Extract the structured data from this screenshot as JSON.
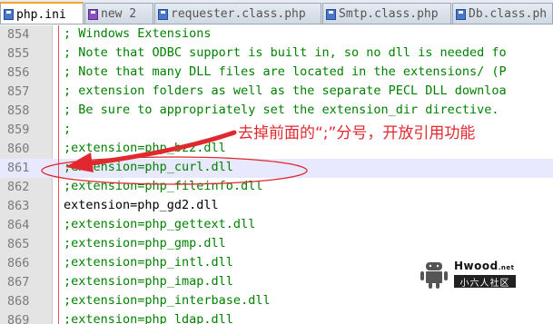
{
  "tabs": [
    {
      "label": "php.ini",
      "icon": "save-icon",
      "active": true
    },
    {
      "label": "new  2",
      "icon": "doc-icon",
      "active": false
    },
    {
      "label": "requester.class.php",
      "icon": "save-icon",
      "active": false
    },
    {
      "label": "Smtp.class.php",
      "icon": "save-icon",
      "active": false
    },
    {
      "label": "Db.class.ph",
      "icon": "save-icon",
      "active": false
    }
  ],
  "editor": {
    "current_line": "861",
    "lines": [
      {
        "num": "854",
        "text": "; Windows Extensions",
        "type": "comment"
      },
      {
        "num": "855",
        "text": "; Note that ODBC support is built in, so no dll is needed fo",
        "type": "comment"
      },
      {
        "num": "856",
        "text": "; Note that many DLL files are located in the extensions/ (P",
        "type": "comment"
      },
      {
        "num": "857",
        "text": "; extension folders as well as the separate PECL DLL downloa",
        "type": "comment"
      },
      {
        "num": "858",
        "text": "; Be sure to appropriately set the extension_dir directive.",
        "type": "comment"
      },
      {
        "num": "859",
        "text": ";",
        "type": "comment"
      },
      {
        "num": "860",
        "text": ";extension=php_bz2.dll",
        "type": "comment"
      },
      {
        "num": "861",
        "text": ";extension=php_curl.dll",
        "type": "comment"
      },
      {
        "num": "862",
        "text": ";extension=php_fileinfo.dll",
        "type": "comment"
      },
      {
        "num": "863",
        "text": "extension=php_gd2.dll",
        "type": "normal"
      },
      {
        "num": "864",
        "text": ";extension=php_gettext.dll",
        "type": "comment"
      },
      {
        "num": "865",
        "text": ";extension=php_gmp.dll",
        "type": "comment"
      },
      {
        "num": "866",
        "text": ";extension=php_intl.dll",
        "type": "comment"
      },
      {
        "num": "867",
        "text": ";extension=php_imap.dll",
        "type": "comment"
      },
      {
        "num": "868",
        "text": ";extension=php_interbase.dll",
        "type": "comment"
      },
      {
        "num": "869",
        "text": ";extension=php_ldap.dll",
        "type": "comment"
      }
    ]
  },
  "annotation": {
    "text": "去掉前面的“;”分号，开放引用功能",
    "color": "#e0282e"
  },
  "watermark": {
    "brand": "Hwood",
    "brand_suffix": ".net",
    "sub": "小六人社区"
  },
  "colors": {
    "comment": "#008000",
    "line_number": "#7a7a7a",
    "current_line_bg": "#e8e8ff",
    "active_tab_accent": "#f5a623"
  }
}
